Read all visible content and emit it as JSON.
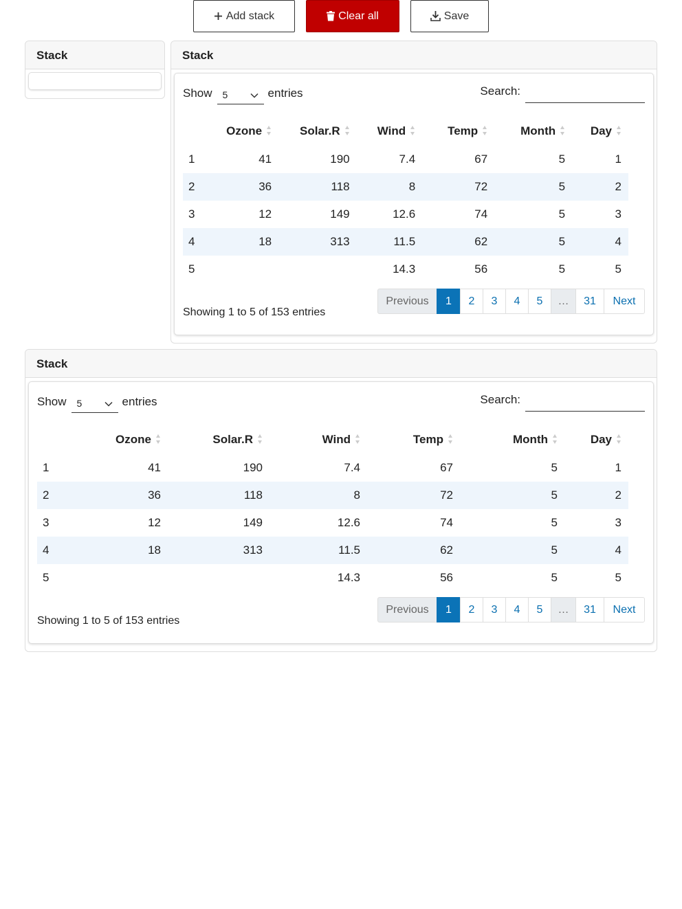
{
  "toolbar": {
    "add_label": "Add stack",
    "clear_label": "Clear all",
    "save_label": "Save",
    "clear_color": "#c00000"
  },
  "panels": {
    "left_title": "Stack",
    "right_title": "Stack",
    "bottom_title": "Stack"
  },
  "table": {
    "show_label": "Show",
    "entries_label": "entries",
    "page_length": "5",
    "search_label": "Search:",
    "search_value": "",
    "columns": [
      "",
      "Ozone",
      "Solar.R",
      "Wind",
      "Temp",
      "Month",
      "Day"
    ],
    "rows": [
      [
        "1",
        "41",
        "190",
        "7.4",
        "67",
        "5",
        "1"
      ],
      [
        "2",
        "36",
        "118",
        "8",
        "72",
        "5",
        "2"
      ],
      [
        "3",
        "12",
        "149",
        "12.6",
        "74",
        "5",
        "3"
      ],
      [
        "4",
        "18",
        "313",
        "11.5",
        "62",
        "5",
        "4"
      ],
      [
        "5",
        "",
        "",
        "14.3",
        "56",
        "5",
        "5"
      ]
    ],
    "info": "Showing 1 to 5 of 153 entries",
    "pagination": {
      "previous": "Previous",
      "pages": [
        "1",
        "2",
        "3",
        "4",
        "5"
      ],
      "ellipsis": "…",
      "last": "31",
      "next": "Next",
      "active": "1"
    }
  },
  "colors": {
    "accent": "#0b73b7",
    "row_stripe": "#eef5fc",
    "danger": "#c00000"
  }
}
